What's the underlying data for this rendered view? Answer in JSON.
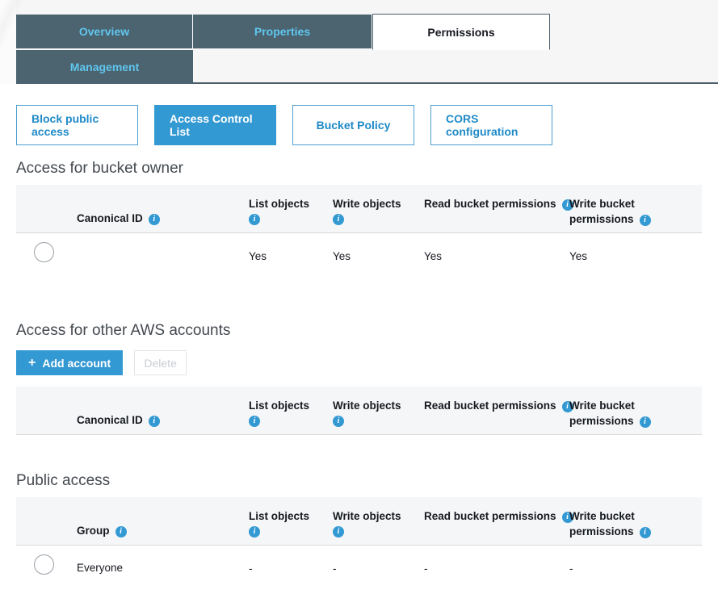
{
  "tabs": {
    "row1": [
      {
        "label": "Overview",
        "active": false
      },
      {
        "label": "Properties",
        "active": false
      },
      {
        "label": "Permissions",
        "active": true
      }
    ],
    "row2": [
      {
        "label": "Management",
        "active": false
      }
    ]
  },
  "subnav": {
    "buttons": [
      {
        "label": "Block public access",
        "selected": false
      },
      {
        "label": "Access Control List",
        "selected": true
      },
      {
        "label": "Bucket Policy",
        "selected": false
      },
      {
        "label": "CORS configuration",
        "selected": false
      }
    ]
  },
  "sections": {
    "bucket_owner": {
      "title": "Access for bucket owner",
      "columns": {
        "name": "Canonical ID",
        "list_objects": "List objects",
        "write_objects": "Write objects",
        "read_bucket_permissions": "Read bucket permissions",
        "write_bucket_permissions": "Write bucket permissions"
      },
      "rows": [
        {
          "name": "",
          "list_objects": "Yes",
          "write_objects": "Yes",
          "read_bucket_permissions": "Yes",
          "write_bucket_permissions": "Yes"
        }
      ]
    },
    "other_accounts": {
      "title": "Access for other AWS accounts",
      "add_button": "Add account",
      "add_button_icon": "plus-icon",
      "delete_button": "Delete",
      "delete_enabled": false,
      "columns": {
        "name": "Canonical ID",
        "list_objects": "List objects",
        "write_objects": "Write objects",
        "read_bucket_permissions": "Read bucket permissions",
        "write_bucket_permissions": "Write bucket permissions"
      },
      "rows": []
    },
    "public_access": {
      "title": "Public access",
      "columns": {
        "name": "Group",
        "list_objects": "List objects",
        "write_objects": "Write objects",
        "read_bucket_permissions": "Read bucket permissions",
        "write_bucket_permissions": "Write bucket permissions"
      },
      "rows": [
        {
          "name": "Everyone",
          "list_objects": "-",
          "write_objects": "-",
          "read_bucket_permissions": "-",
          "write_bucket_permissions": "-"
        }
      ]
    }
  },
  "icons": {
    "info": "info-icon",
    "plus": "plus-icon",
    "plus_glyph": "+",
    "info_glyph": "i"
  },
  "colors": {
    "tab_inactive_bg": "#4c6370",
    "tab_inactive_text": "#5fc7ee",
    "accent_blue": "#3399d3",
    "link_blue": "#1f8ac7",
    "header_row_bg": "#f5f6f7",
    "disabled_text": "#c9cdd3"
  }
}
